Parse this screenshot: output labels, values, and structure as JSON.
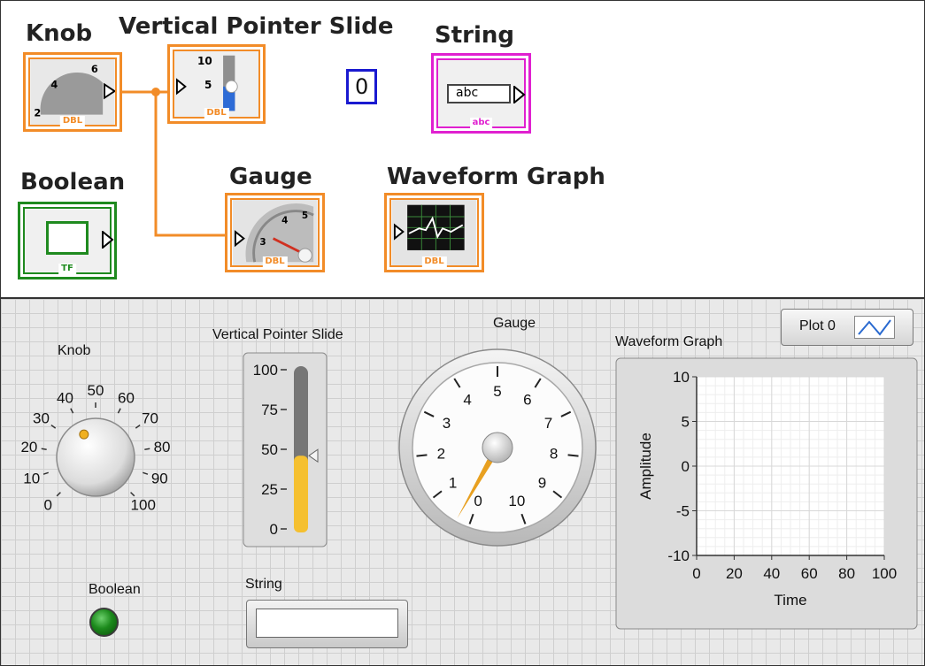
{
  "block_diagram": {
    "terminals": {
      "knob": {
        "label": "Knob",
        "type": "DBL"
      },
      "slide": {
        "label": "Vertical Pointer Slide",
        "type": "DBL",
        "scale": [
          "10",
          "5"
        ]
      },
      "numeric_constant": {
        "value": "0"
      },
      "string": {
        "label": "String",
        "type": "abc",
        "field": "abc"
      },
      "boolean": {
        "label": "Boolean",
        "type": "TF"
      },
      "gauge": {
        "label": "Gauge",
        "type": "DBL"
      },
      "graph": {
        "label": "Waveform Graph",
        "type": "DBL"
      }
    },
    "colors": {
      "numeric": "#f28c28",
      "string": "#e020d0",
      "boolean": "#1f8a1f",
      "constant": "#1a1ad0"
    }
  },
  "front_panel": {
    "knob": {
      "label": "Knob",
      "ticks": [
        "0",
        "10",
        "20",
        "30",
        "40",
        "50",
        "60",
        "70",
        "80",
        "90",
        "100"
      ],
      "value": 40
    },
    "slide": {
      "label": "Vertical Pointer Slide",
      "ticks": [
        "100",
        "75",
        "50",
        "25",
        "0"
      ],
      "value": 46,
      "fill_color": "#f5c030"
    },
    "gauge": {
      "label": "Gauge",
      "ticks": [
        "0",
        "1",
        "2",
        "3",
        "4",
        "5",
        "6",
        "7",
        "8",
        "9",
        "10"
      ],
      "value": 0.3,
      "needle_color": "#e8a020"
    },
    "graph": {
      "label": "Waveform Graph",
      "legend": {
        "plot_name": "Plot 0"
      },
      "y_axis": {
        "title": "Amplitude",
        "ticks": [
          "10",
          "5",
          "0",
          "-5",
          "-10"
        ]
      },
      "x_axis": {
        "title": "Time",
        "ticks": [
          "0",
          "20",
          "40",
          "60",
          "80",
          "100"
        ]
      }
    },
    "boolean": {
      "label": "Boolean",
      "state": "off",
      "color": "#1c8a1c"
    },
    "string": {
      "label": "String",
      "value": ""
    }
  }
}
